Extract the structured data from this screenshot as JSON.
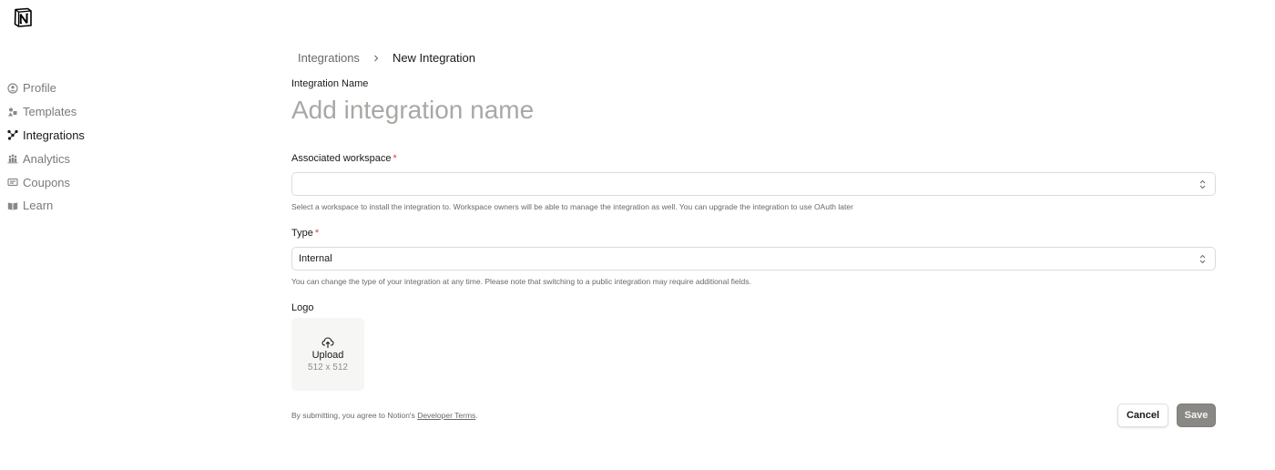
{
  "app": {
    "logo_icon": "notion-logo-icon"
  },
  "sidebar": {
    "items": [
      {
        "label": "Profile",
        "icon": "profile-icon",
        "active": false
      },
      {
        "label": "Templates",
        "icon": "templates-icon",
        "active": false
      },
      {
        "label": "Integrations",
        "icon": "integrations-icon",
        "active": true
      },
      {
        "label": "Analytics",
        "icon": "analytics-icon",
        "active": false
      },
      {
        "label": "Coupons",
        "icon": "coupons-icon",
        "active": false
      },
      {
        "label": "Learn",
        "icon": "learn-icon",
        "active": false
      }
    ]
  },
  "breadcrumb": {
    "parent": "Integrations",
    "current": "New Integration"
  },
  "form": {
    "name": {
      "label": "Integration Name",
      "value": "",
      "placeholder": "Add integration name"
    },
    "workspace": {
      "label": "Associated workspace",
      "required_mark": "*",
      "value": "",
      "help": "Select a workspace to install the integration to. Workspace owners will be able to manage the integration as well. You can upgrade the integration to use OAuth later"
    },
    "type": {
      "label": "Type",
      "required_mark": "*",
      "value": "Internal",
      "help": "You can change the type of your integration at any time. Please note that switching to a public integration may require additional fields."
    },
    "logo": {
      "label": "Logo",
      "upload_label": "Upload",
      "upload_size": "512 x 512"
    },
    "terms": {
      "prefix": "By submitting, you agree to Notion's",
      "link": "Developer Terms",
      "suffix": "."
    }
  },
  "actions": {
    "cancel_label": "Cancel",
    "save_label": "Save"
  },
  "colors": {
    "required": "#e03e3e",
    "save_bg": "#898884",
    "text_muted": "#6b6965"
  }
}
